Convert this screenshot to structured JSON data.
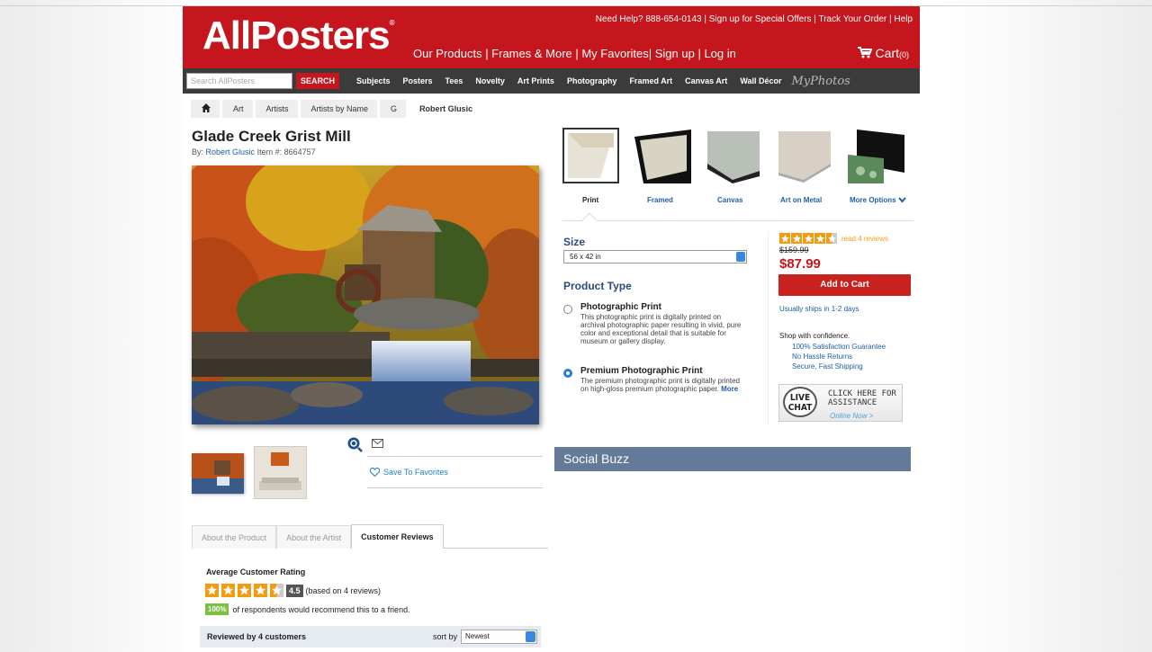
{
  "header": {
    "logo": "AllPosters",
    "logo_mark": "®",
    "top_links": "Need Help? 888-654-0143 | Sign up for Special Offers | Track Your Order | Help",
    "main_links": "Our Products | Frames & More | My Favorites| Sign up | Log in",
    "cart_label": "Cart",
    "cart_count": "(0)"
  },
  "nav": {
    "search_placeholder": "Search AllPosters",
    "search_button": "SEARCH",
    "items": [
      "Subjects",
      "Posters",
      "Tees",
      "Novelty",
      "Art Prints",
      "Photography",
      "Framed Art",
      "Canvas Art",
      "Wall Décor"
    ],
    "myphotos": "MyPhotos"
  },
  "breadcrumb": [
    "Art",
    "Artists",
    "Artists by Name",
    "G",
    "Robert Glusic"
  ],
  "product": {
    "title": "Glade Creek Grist Mill",
    "by_label": "By:",
    "artist": "Robert Glusic",
    "item_label": "Item #: 8664757",
    "save_favorites": "Save To Favorites"
  },
  "tabs": [
    "About the Product",
    "About the Artist",
    "Customer Reviews"
  ],
  "reviews": {
    "avg_heading": "Average Customer Rating",
    "rating": "4.5",
    "based_on": "(based on 4 reviews)",
    "percent": "100%",
    "recommend_text": "of respondents would recommend this to a friend.",
    "reviewed_by": "Reviewed by 4 customers",
    "sort_label": "sort by",
    "sort_value": "Newest"
  },
  "options": {
    "labels": [
      "Print",
      "Framed",
      "Canvas",
      "Art on Metal",
      "More Options"
    ],
    "size_label": "Size",
    "size_value": "56 x 42 in",
    "product_type_label": "Product Type",
    "type1_title": "Photographic Print",
    "type1_desc": "This photographic print is digitally printed on archival photographic paper resulting in vivid, pure color and exceptional detail that is suitable for museum or gallery display.",
    "type2_title": "Premium Photographic Print",
    "type2_desc": "The premium photographic print is digitally printed on high-gloss premium photographic paper.",
    "type2_more": "More"
  },
  "pricebox": {
    "read_reviews": "read 4 reviews",
    "old_price": "$159.99",
    "price": "$87.99",
    "add_to_cart": "Add to Cart",
    "ships": "Usually ships in 1-2 days",
    "confidence": "Shop with confidence.",
    "guarantees": [
      "100% Satisfaction Guarantee",
      "No Hassle Returns",
      "Secure, Fast Shipping"
    ],
    "livechat_badge": "LIVE CHAT",
    "livechat_text": "CLICK HERE FOR ASSISTANCE",
    "livechat_status": "Online Now >"
  },
  "social": {
    "title": "Social Buzz"
  },
  "colors": {
    "brand_red": "#c5161d",
    "nav_dark": "#3b3b3b",
    "link_blue": "#1f5fa8",
    "star_orange": "#f39c12",
    "social_bar": "#657a98"
  }
}
